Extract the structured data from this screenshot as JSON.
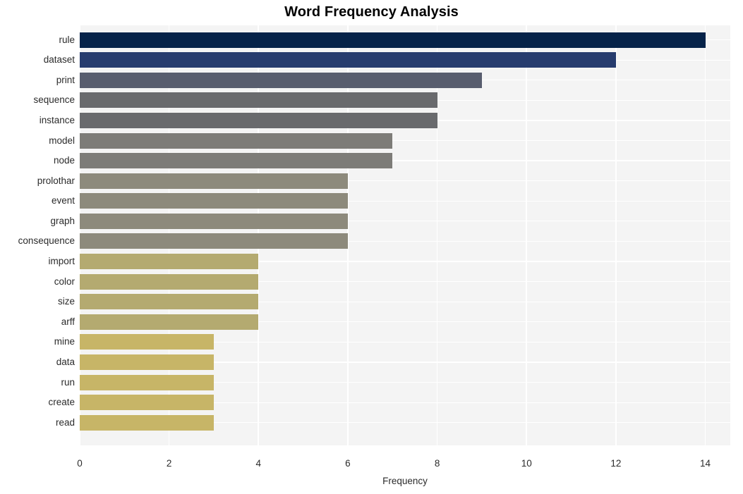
{
  "chart_data": {
    "type": "bar",
    "orientation": "horizontal",
    "title": "Word Frequency Analysis",
    "xlabel": "Frequency",
    "ylabel": "",
    "xlim": [
      0,
      14.56
    ],
    "xticks": [
      0,
      2,
      4,
      6,
      8,
      10,
      12,
      14
    ],
    "xtick_labels": [
      "0",
      "2",
      "4",
      "6",
      "8",
      "10",
      "12",
      "14"
    ],
    "grid": true,
    "legend": false,
    "categories": [
      "rule",
      "dataset",
      "print",
      "sequence",
      "instance",
      "model",
      "node",
      "prolothar",
      "event",
      "graph",
      "consequence",
      "import",
      "color",
      "size",
      "arff",
      "mine",
      "data",
      "run",
      "create",
      "read"
    ],
    "values": [
      14,
      12,
      9,
      8,
      8,
      7,
      7,
      6,
      6,
      6,
      6,
      4,
      4,
      4,
      4,
      3,
      3,
      3,
      3,
      3
    ],
    "bar_colors": [
      "#062349",
      "#273c6e",
      "#585d6e",
      "#696a6d",
      "#696a6d",
      "#7d7c78",
      "#7d7c78",
      "#8d8a7c",
      "#8d8a7c",
      "#8d8a7c",
      "#8d8a7c",
      "#b4aa70",
      "#b4aa70",
      "#b4aa70",
      "#b4aa70",
      "#c7b567",
      "#c7b567",
      "#c7b567",
      "#c7b567",
      "#c7b567"
    ],
    "plot_background": "#f4f4f4",
    "grid_color": "#ffffff",
    "figure_background": "#ffffff",
    "text_color": "#2b2b2b",
    "title_color": "#000000"
  }
}
